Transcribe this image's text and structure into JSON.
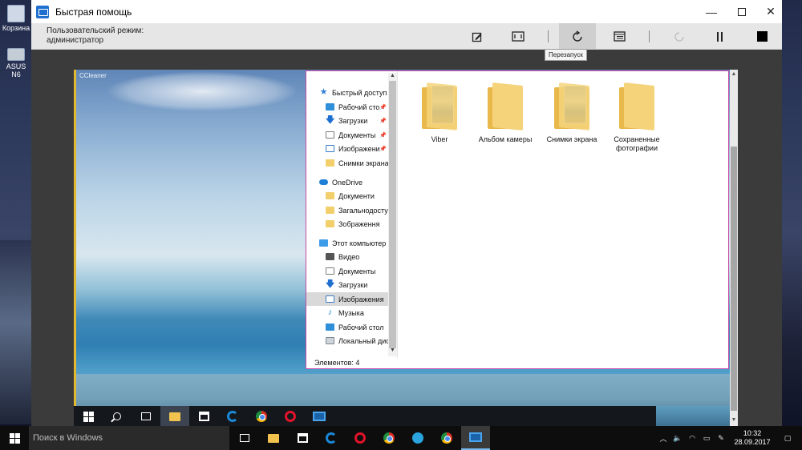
{
  "host_desktop": {
    "icons": [
      {
        "label": "Корзина"
      },
      {
        "label": "ASUS N6"
      }
    ]
  },
  "quick_assist": {
    "title": "Быстрая помощь",
    "mode_line1": "Пользовательский режим:",
    "mode_line2": "администратор",
    "tooltip": "Перезапуск",
    "toolbar_icons": [
      "annotate-icon",
      "fit-screen-icon",
      "restart-icon",
      "task-manager-icon",
      "reconnect-icon",
      "pause-icon",
      "stop-icon"
    ]
  },
  "remote": {
    "desktop_label": "CCleaner",
    "explorer": {
      "nav": [
        {
          "label": "Быстрый доступ",
          "icon": "star",
          "pinned": false
        },
        {
          "label": "Рабочий сто",
          "icon": "desk",
          "pinned": true
        },
        {
          "label": "Загрузки",
          "icon": "arrow",
          "pinned": true
        },
        {
          "label": "Документы",
          "icon": "doc",
          "pinned": true
        },
        {
          "label": "Изображени",
          "icon": "pic",
          "pinned": true
        },
        {
          "label": "Снимки экрана",
          "icon": "folder",
          "pinned": false
        },
        {
          "label": "OneDrive",
          "icon": "cloud",
          "pinned": false
        },
        {
          "label": "Документи",
          "icon": "folder",
          "pinned": false
        },
        {
          "label": "Загальнодоступ",
          "icon": "folder",
          "pinned": false
        },
        {
          "label": "Зображення",
          "icon": "folder",
          "pinned": false
        },
        {
          "label": "Этот компьютер",
          "icon": "pc",
          "pinned": false
        },
        {
          "label": "Видео",
          "icon": "video",
          "pinned": false
        },
        {
          "label": "Документы",
          "icon": "doc",
          "pinned": false
        },
        {
          "label": "Загрузки",
          "icon": "arrow",
          "pinned": false
        },
        {
          "label": "Изображения",
          "icon": "pic",
          "pinned": false
        },
        {
          "label": "Музыка",
          "icon": "music",
          "pinned": false
        },
        {
          "label": "Рабочий стол",
          "icon": "desk",
          "pinned": false
        },
        {
          "label": "Локальный дис",
          "icon": "disk",
          "pinned": false
        }
      ],
      "selected_nav": "Изображения",
      "items": [
        {
          "label": "Viber",
          "thumb": true
        },
        {
          "label": "Альбом камеры",
          "thumb": false
        },
        {
          "label": "Снимки экрана",
          "thumb": true
        },
        {
          "label": "Сохраненные фотографии",
          "thumb": false
        }
      ],
      "status": "Элементов: 4"
    }
  },
  "taskbar": {
    "search_placeholder": "Поиск в Windows",
    "time": "10:32",
    "date": "28.09.2017"
  }
}
